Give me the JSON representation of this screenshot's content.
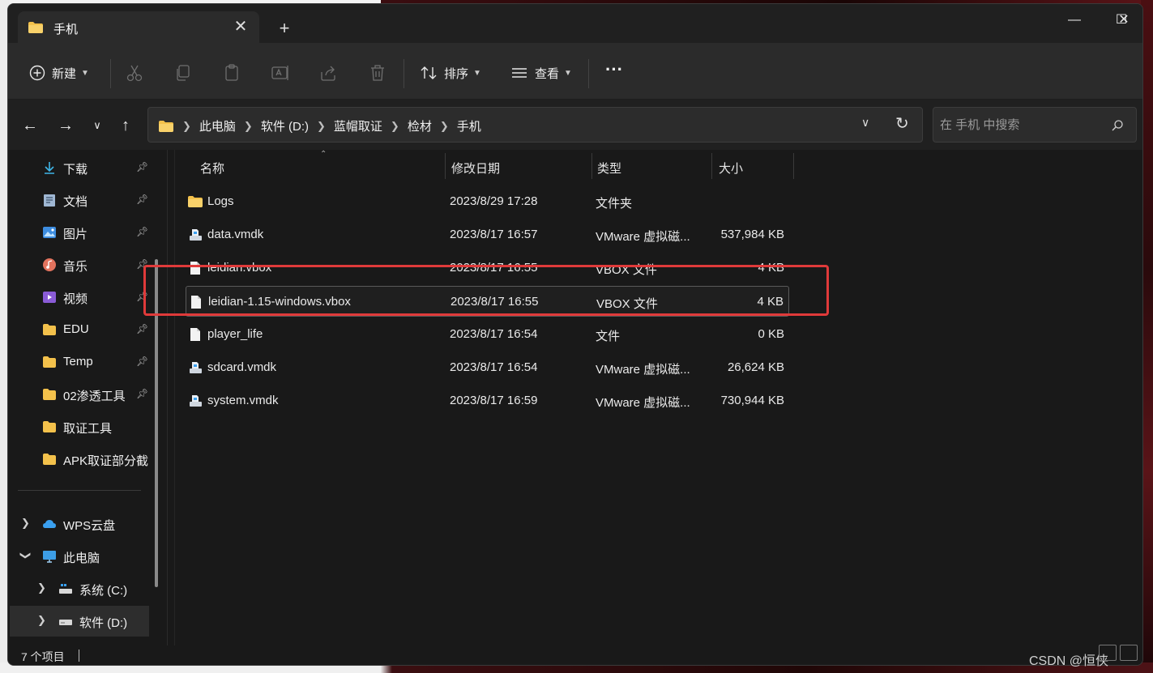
{
  "tab": {
    "title": "手机",
    "new_tab": "+"
  },
  "window_controls": {
    "minimize": "—",
    "maximize": "☐",
    "close": "✕"
  },
  "toolbar": {
    "new_label": "新建",
    "sort_label": "排序",
    "view_label": "查看",
    "more_label": "···"
  },
  "address": {
    "crumbs": [
      "此电脑",
      "软件 (D:)",
      "蓝帽取证",
      "检材",
      "手机"
    ]
  },
  "search": {
    "placeholder": "在 手机 中搜索"
  },
  "sidebar": {
    "quick": [
      {
        "label": "下载",
        "icon": "download-icon"
      },
      {
        "label": "文档",
        "icon": "document-icon"
      },
      {
        "label": "图片",
        "icon": "picture-icon"
      },
      {
        "label": "音乐",
        "icon": "music-icon"
      },
      {
        "label": "视频",
        "icon": "video-icon"
      },
      {
        "label": "EDU",
        "icon": "folder-icon"
      },
      {
        "label": "Temp",
        "icon": "folder-icon"
      },
      {
        "label": "02渗透工具",
        "icon": "folder-icon"
      },
      {
        "label": "取证工具",
        "icon": "folder-icon"
      },
      {
        "label": "APK取证部分截",
        "icon": "folder-icon"
      }
    ],
    "tree": [
      {
        "label": "WPS云盘",
        "icon": "cloud-icon"
      },
      {
        "label": "此电脑",
        "icon": "computer-icon"
      },
      {
        "label": "系统 (C:)",
        "icon": "drive-icon"
      },
      {
        "label": "软件 (D:)",
        "icon": "drive-icon"
      }
    ]
  },
  "columns": {
    "name": "名称",
    "date": "修改日期",
    "type": "类型",
    "size": "大小"
  },
  "files": [
    {
      "name": "Logs",
      "date": "2023/8/29 17:28",
      "type": "文件夹",
      "size": "",
      "icon": "folder-icon"
    },
    {
      "name": "data.vmdk",
      "date": "2023/8/17 16:57",
      "type": "VMware 虚拟磁...",
      "size": "537,984 KB",
      "icon": "disk-file-icon"
    },
    {
      "name": "leidian.vbox",
      "date": "2023/8/17 16:55",
      "type": "VBOX 文件",
      "size": "4 KB",
      "icon": "file-icon"
    },
    {
      "name": "leidian-1.15-windows.vbox",
      "date": "2023/8/17 16:55",
      "type": "VBOX 文件",
      "size": "4 KB",
      "icon": "file-icon"
    },
    {
      "name": "player_life",
      "date": "2023/8/17 16:54",
      "type": "文件",
      "size": "0 KB",
      "icon": "file-icon"
    },
    {
      "name": "sdcard.vmdk",
      "date": "2023/8/17 16:54",
      "type": "VMware 虚拟磁...",
      "size": "26,624 KB",
      "icon": "disk-file-icon"
    },
    {
      "name": "system.vmdk",
      "date": "2023/8/17 16:59",
      "type": "VMware 虚拟磁...",
      "size": "730,944 KB",
      "icon": "disk-file-icon"
    }
  ],
  "status": {
    "count": "7 个项目"
  },
  "watermark": "CSDN @恒侠",
  "colors": {
    "highlight_box": "#e03a3a",
    "folder": "#f3c14b",
    "background": "#191919"
  }
}
